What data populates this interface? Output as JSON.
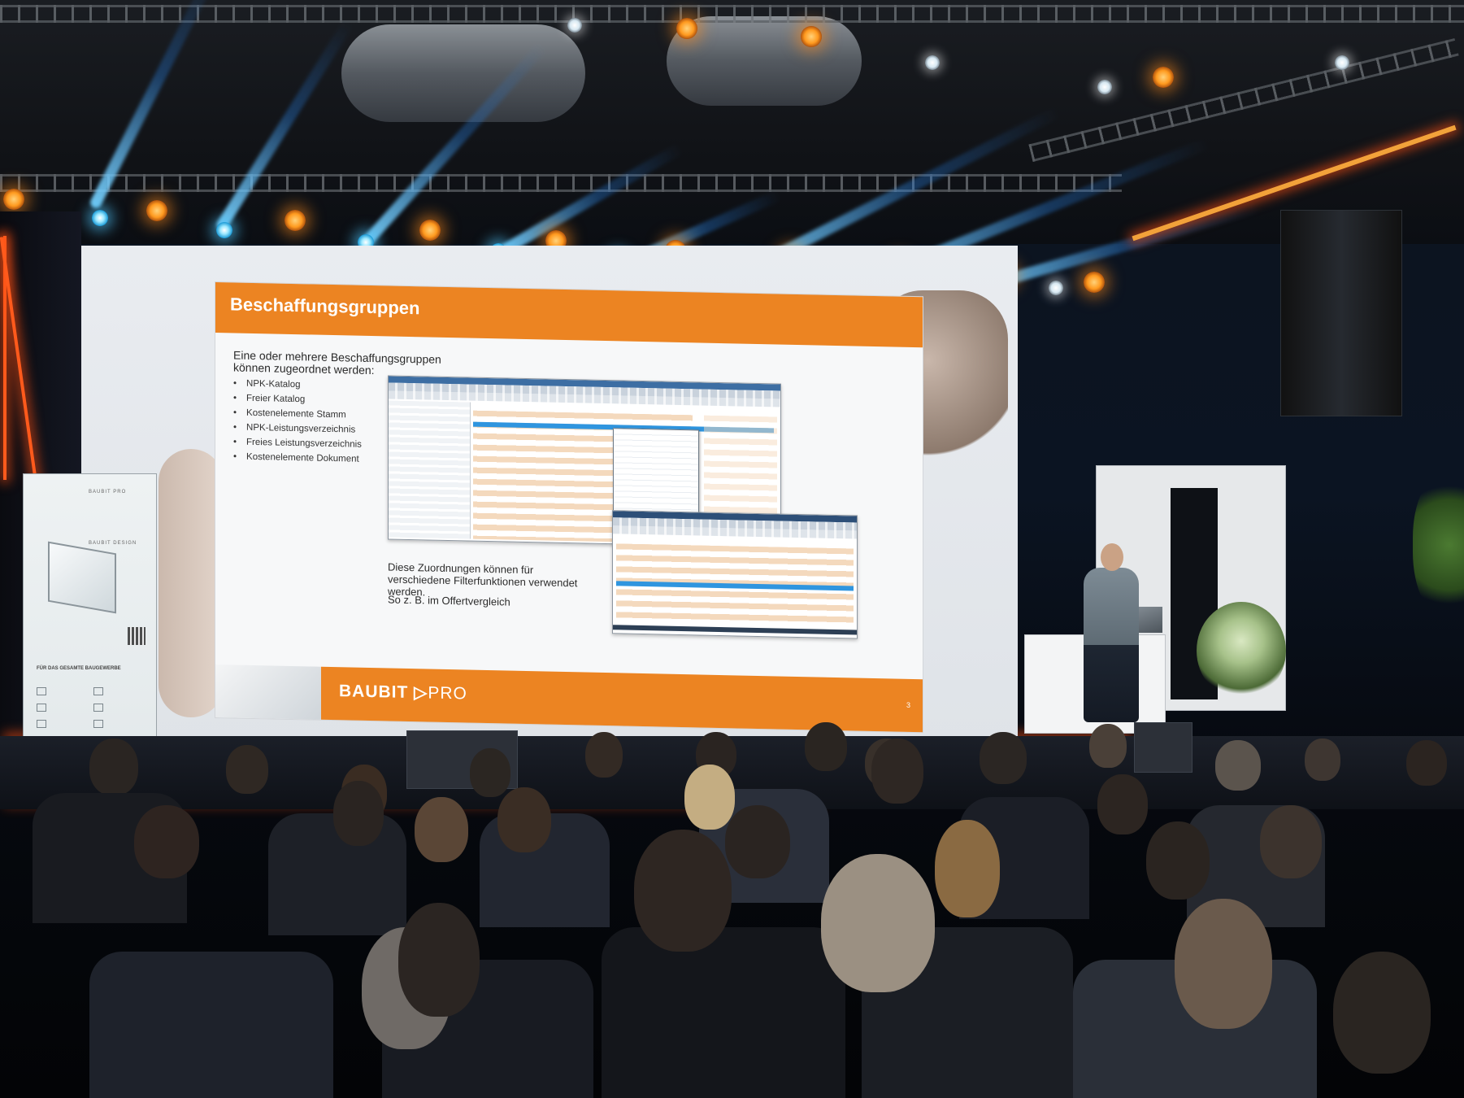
{
  "slide": {
    "title": "Beschaffungsgruppen",
    "intro": "Eine oder mehrere Beschaffungsgruppen können zugeordnet werden:",
    "bullets": [
      "NPK-Katalog",
      "Freier Katalog",
      "Kostenelemente Stamm",
      "NPK-Leistungsverzeichnis",
      "Freies Leistungsverzeichnis",
      "Kostenelemente Dokument"
    ],
    "body_line1": "Diese Zuordnungen können für verschiedene Filterfunktionen verwendet werden.",
    "body_line2": "So z. B. im Offertvergleich",
    "footer_logo_bold": "BAUBIT",
    "footer_logo_light": "PRO",
    "page_number": "3"
  },
  "rollup_banner": {
    "line1": "BAUBIT PRO",
    "line2": "BAUBIT DESIGN",
    "line3": "FÜR DAS GESAMTE BAUGEWERBE"
  },
  "colors": {
    "slide_accent": "#ec8422",
    "stage_neon": "#ff5a1c",
    "beam": "#2fa8f0"
  }
}
